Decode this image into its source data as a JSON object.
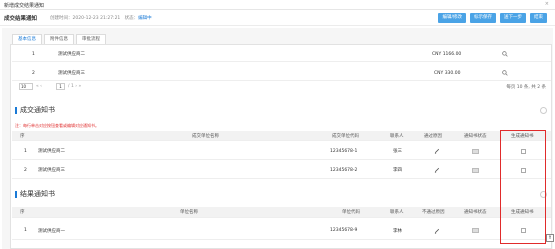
{
  "window": {
    "title": "新增成交结果通知",
    "close": "×"
  },
  "header": {
    "title": "成交结果通知",
    "created_label": "创建时间：",
    "created_value": "2020-12-23 21:27:21",
    "status_label": "状态：",
    "status_value": "编辑中",
    "actions": [
      "编辑/修改",
      "标示保存",
      "送下一步",
      "结束"
    ]
  },
  "tabs": [
    "基本信息",
    "附件信息",
    "审批流程"
  ],
  "supplier_rows": [
    {
      "no": "1",
      "name": "测试供应商二",
      "amount": "CNY 1166.00"
    },
    {
      "no": "2",
      "name": "测试供应商三",
      "amount": "CNY 330.00"
    }
  ],
  "pager": {
    "size": "10",
    "nav_left": "«  ‹",
    "page": "1",
    "page_of": "/ 1  ›  »",
    "total": "每页 10 条, 共 2 条"
  },
  "award_section": {
    "title": "成交通知书",
    "note": "注：每行单击对应按钮查看或编辑对应通知书。",
    "headers": [
      "序",
      "成交单位名称",
      "成交单位代码",
      "联系人",
      "通过原因",
      "通知书状态",
      "生成通知书"
    ],
    "rows": [
      {
        "no": "1",
        "name": "测试供应商二",
        "code": "12345678-1",
        "contact": "张三"
      },
      {
        "no": "2",
        "name": "测试供应商三",
        "code": "12345678-2",
        "contact": "李四"
      }
    ]
  },
  "result_section": {
    "title": "结果通知书",
    "headers": [
      "序",
      "单位名称",
      "单位代码",
      "联系人",
      "不通过原因",
      "通知书状态",
      "生成通知书"
    ],
    "rows": [
      {
        "no": "1",
        "name": "测试供应商一",
        "code": "12345678-9",
        "contact": "李林"
      }
    ]
  },
  "colors": {
    "accent": "#1a7ad6",
    "button": "#4aa3e6",
    "highlight": "#e02b2b"
  }
}
